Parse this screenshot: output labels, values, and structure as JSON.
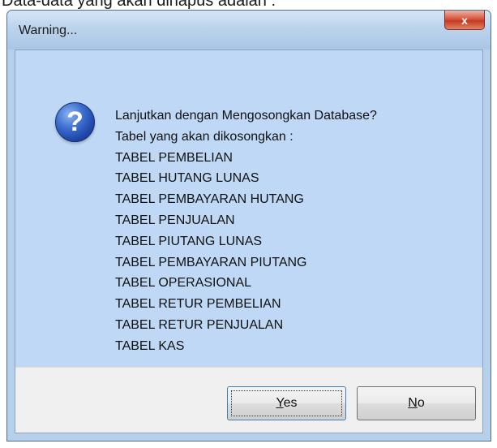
{
  "document": {
    "text": "Data-data yang akan dihapus adalah :"
  },
  "dialog": {
    "title": "Warning...",
    "close_glyph": "x",
    "icon": "question-icon",
    "icon_glyph": "?",
    "message_lines": [
      "Lanjutkan dengan Mengosongkan Database?",
      "Tabel yang akan dikosongkan :",
      "TABEL PEMBELIAN",
      "TABEL HUTANG LUNAS",
      "TABEL PEMBAYARAN HUTANG",
      "TABEL PENJUALAN",
      "TABEL PIUTANG LUNAS",
      "TABEL PEMBAYARAN PIUTANG",
      "TABEL OPERASIONAL",
      "TABEL RETUR PEMBELIAN",
      "TABEL RETUR PENJUALAN",
      "TABEL KAS"
    ],
    "buttons": {
      "yes": {
        "mnemonic": "Y",
        "rest": "es"
      },
      "no": {
        "mnemonic": "N",
        "rest": "o"
      }
    }
  },
  "colors": {
    "dialog_background": "#bed8f6",
    "footer_background": "#f0f0f0",
    "close_button": "#c43a22",
    "question_icon": "#1e47a8"
  }
}
